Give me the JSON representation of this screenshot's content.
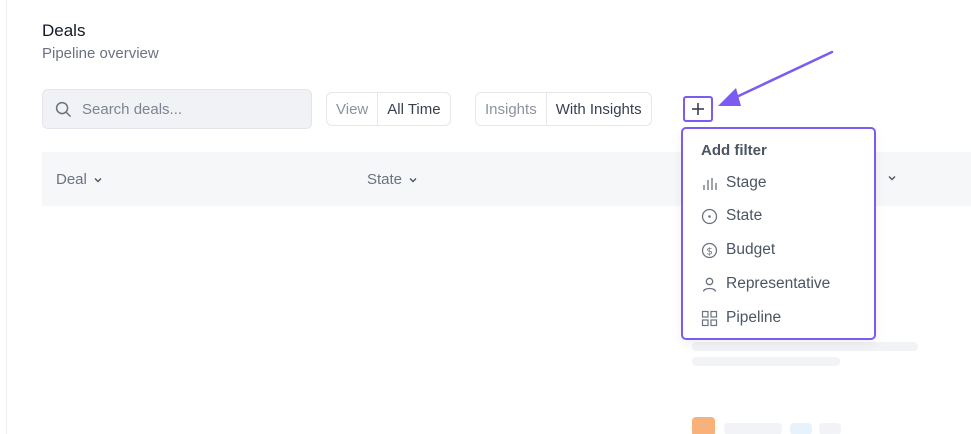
{
  "header": {
    "title": "Deals",
    "subtitle": "Pipeline overview"
  },
  "toolbar": {
    "search_placeholder": "Search deals...",
    "view_key": "View",
    "view_value": "All Time",
    "insights_key": "Insights",
    "insights_value": "With Insights",
    "add_label": "+"
  },
  "table": {
    "columns": [
      "Deal",
      "State"
    ]
  },
  "filter_menu": {
    "title": "Add filter",
    "items": [
      {
        "label": "Stage",
        "icon": "bar-chart-icon"
      },
      {
        "label": "State",
        "icon": "circle-dot-icon"
      },
      {
        "label": "Budget",
        "icon": "dollar-circle-icon"
      },
      {
        "label": "Representative",
        "icon": "user-icon"
      },
      {
        "label": "Pipeline",
        "icon": "grid-icon"
      }
    ]
  },
  "colors": {
    "accent": "#7c5cf0",
    "muted_text": "#6b7280"
  }
}
